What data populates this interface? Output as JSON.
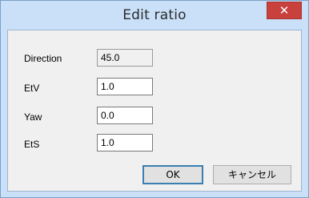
{
  "window": {
    "title": "Edit ratio",
    "close_glyph": "✕"
  },
  "fields": [
    {
      "label": "Direction",
      "value": "45.0",
      "readonly": true
    },
    {
      "label": "EtV",
      "value": "1.0",
      "readonly": false
    },
    {
      "label": "Yaw",
      "value": "0.0",
      "readonly": false
    },
    {
      "label": "EtS",
      "value": "1.0",
      "readonly": false
    }
  ],
  "buttons": {
    "ok_label": "OK",
    "cancel_label": "キャンセル"
  },
  "colors": {
    "titlebar": "#c9e0f8",
    "close_button": "#c8413c",
    "client_background": "#f0f0f0",
    "default_button_border": "#3c7fb1"
  }
}
